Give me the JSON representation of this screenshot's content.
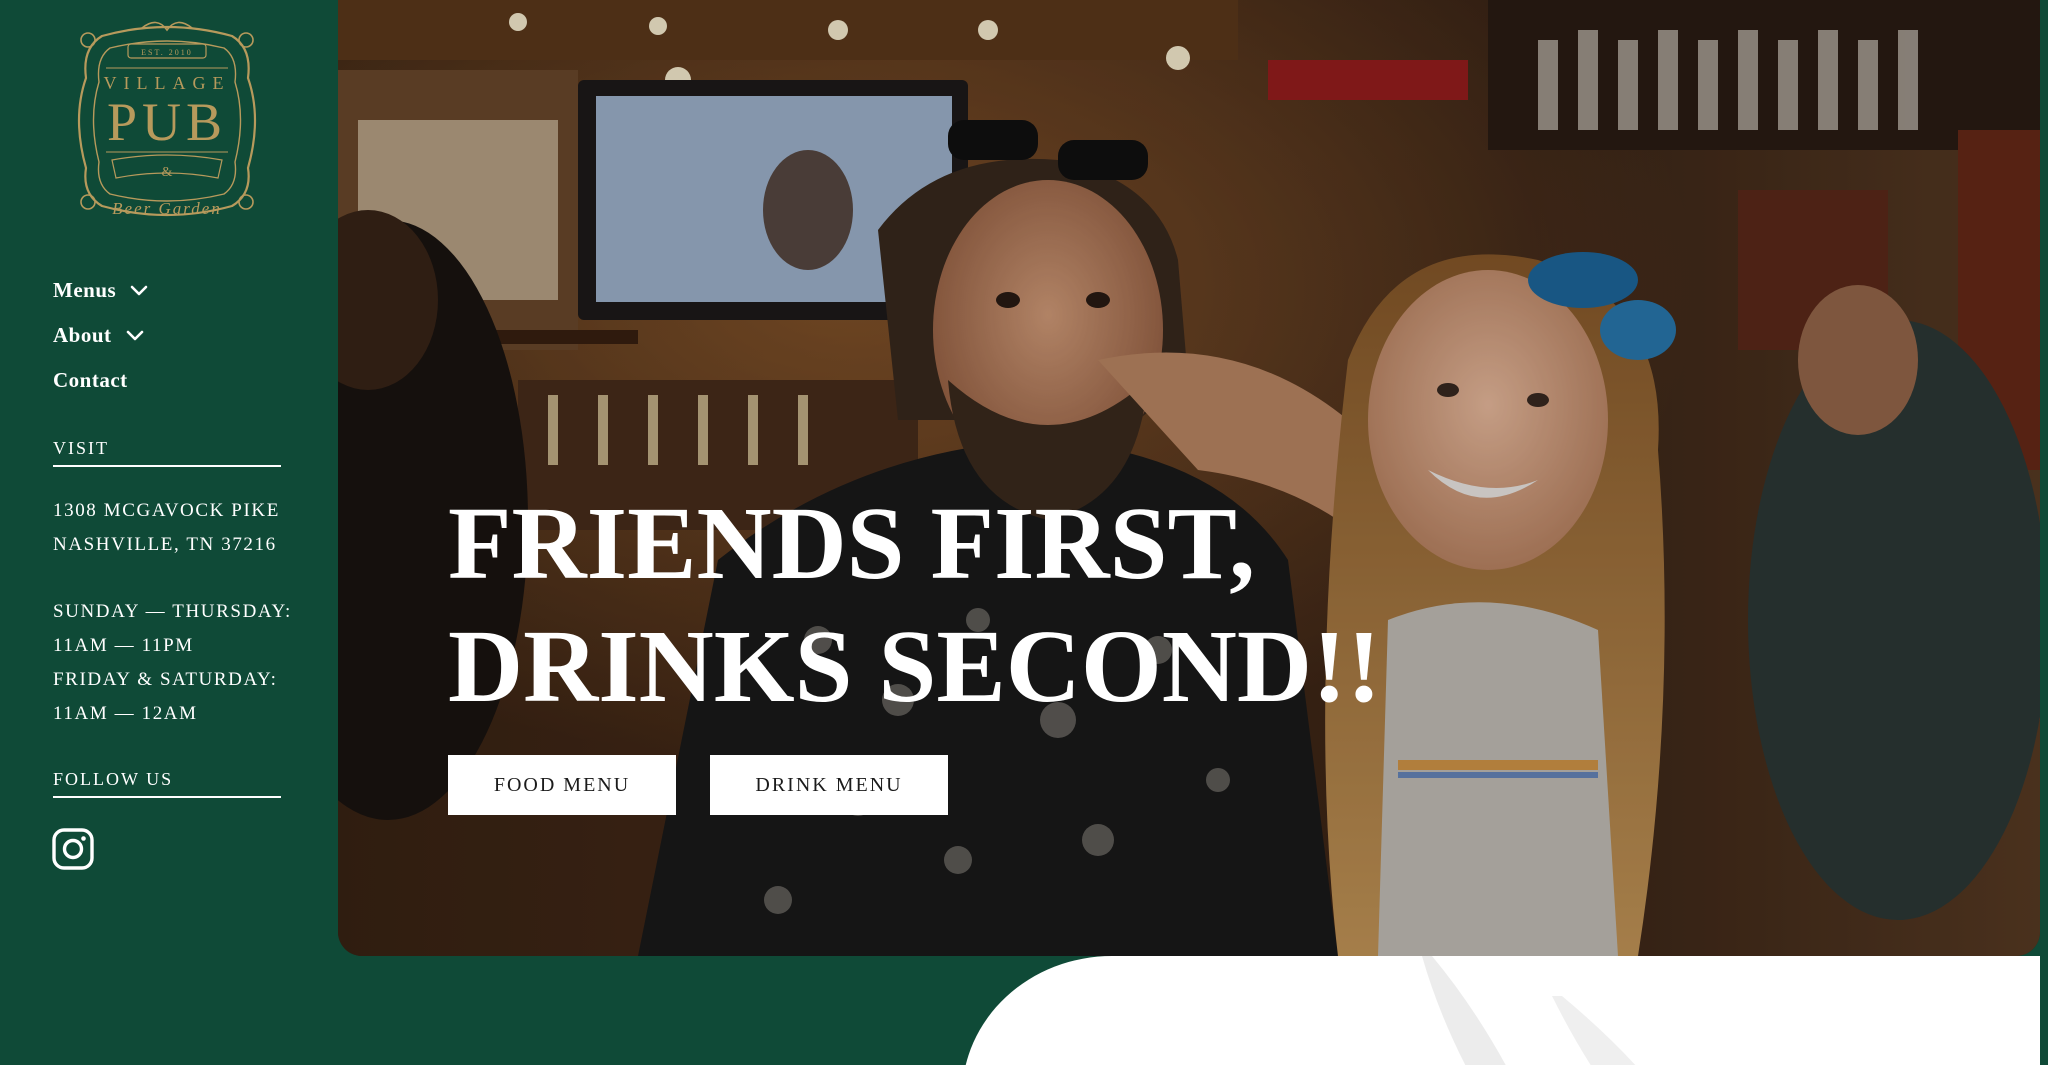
{
  "brand": {
    "logo_top": "EST. 2010",
    "logo_line1": "VILLAGE",
    "logo_line2": "PUB",
    "logo_amp": "&",
    "logo_line3": "Beer Garden"
  },
  "nav": {
    "items": [
      {
        "label": "Menus",
        "has_dropdown": true,
        "icon": "chevron-down-icon"
      },
      {
        "label": "About",
        "has_dropdown": true,
        "icon": "chevron-down-icon"
      },
      {
        "label": "Contact",
        "has_dropdown": false
      }
    ]
  },
  "visit": {
    "heading": "VISIT",
    "address_line1": "1308 MCGAVOCK PIKE",
    "address_line2": "NASHVILLE, TN 37216",
    "hours_line1": "SUNDAY — THURSDAY:",
    "hours_line2": "11AM — 11PM",
    "hours_line3": "FRIDAY & SATURDAY:",
    "hours_line4": "11AM — 12AM"
  },
  "follow": {
    "heading": "FOLLOW US",
    "icon": "instagram-icon"
  },
  "hero": {
    "title_line1": "FRIENDS FIRST,",
    "title_line2": "DRINKS SECOND!!",
    "food_button": "FOOD MENU",
    "drink_button": "DRINK MENU"
  },
  "colors": {
    "sidebar_bg": "#0f4a37",
    "logo_gold": "#b79a5c",
    "text": "#ffffff",
    "button_bg": "#ffffff",
    "button_text": "#1b1b1b"
  }
}
